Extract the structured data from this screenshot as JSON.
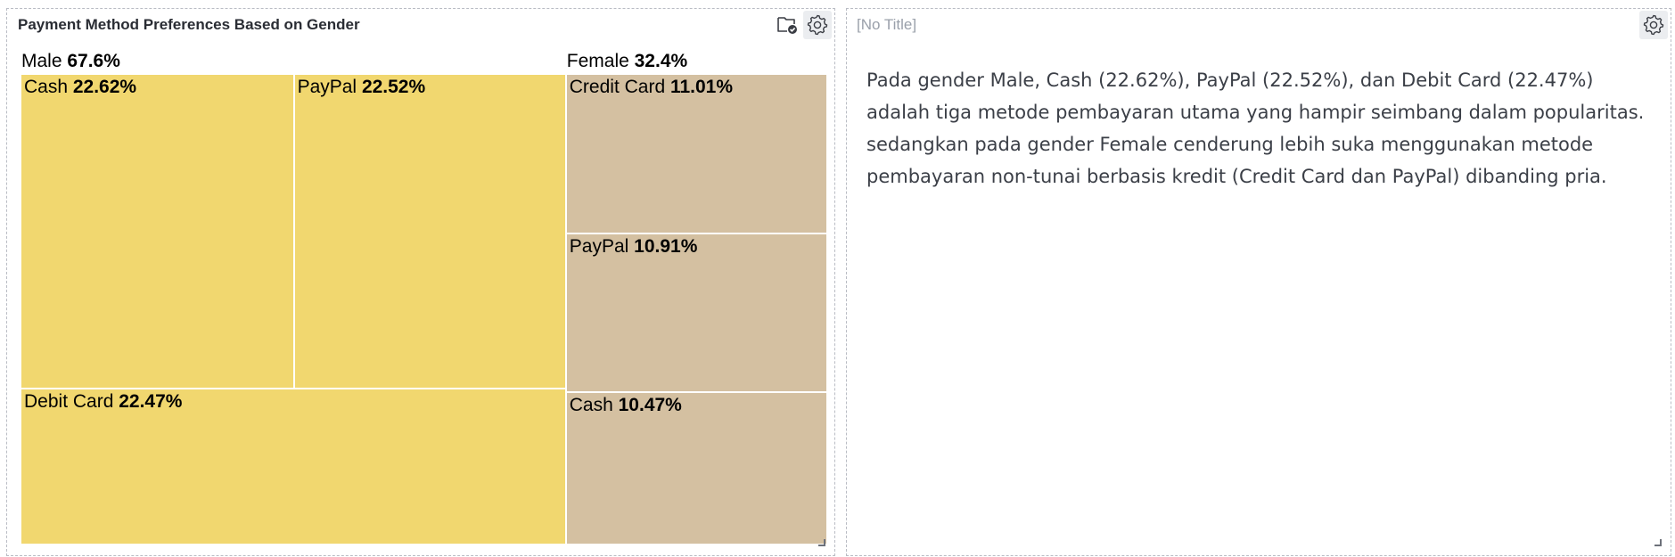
{
  "panels": {
    "left": {
      "title": "Payment Method Preferences Based on Gender",
      "icons": [
        "folder-check-icon",
        "gear-icon"
      ]
    },
    "right": {
      "title": "[No Title]",
      "icons": [
        "gear-icon"
      ],
      "text": "Pada gender Male, Cash (22.62%), PayPal (22.52%), dan Debit Card (22.47%) adalah tiga metode pembayaran utama yang hampir seimbang dalam popularitas. sedangkan pada gender Female cenderung lebih suka menggunakan metode pembayaran non-tunai berbasis kredit (Credit Card dan PayPal) dibanding pria."
    }
  },
  "colors": {
    "male_tile": "#f1d76f",
    "female_tile": "#d4c0a1"
  },
  "chart_data": {
    "type": "treemap",
    "title": "Payment Method Preferences Based on Gender",
    "unit": "%",
    "groups": [
      {
        "name": "Male",
        "value": 67.6,
        "value_label": "67.6%",
        "children": [
          {
            "name": "Cash",
            "value": 22.62,
            "value_label": "22.62%"
          },
          {
            "name": "PayPal",
            "value": 22.52,
            "value_label": "22.52%"
          },
          {
            "name": "Debit Card",
            "value": 22.47,
            "value_label": "22.47%"
          }
        ]
      },
      {
        "name": "Female",
        "value": 32.4,
        "value_label": "32.4%",
        "children": [
          {
            "name": "Credit Card",
            "value": 11.01,
            "value_label": "11.01%"
          },
          {
            "name": "PayPal",
            "value": 10.91,
            "value_label": "10.91%"
          },
          {
            "name": "Cash",
            "value": 10.47,
            "value_label": "10.47%"
          }
        ]
      }
    ]
  }
}
